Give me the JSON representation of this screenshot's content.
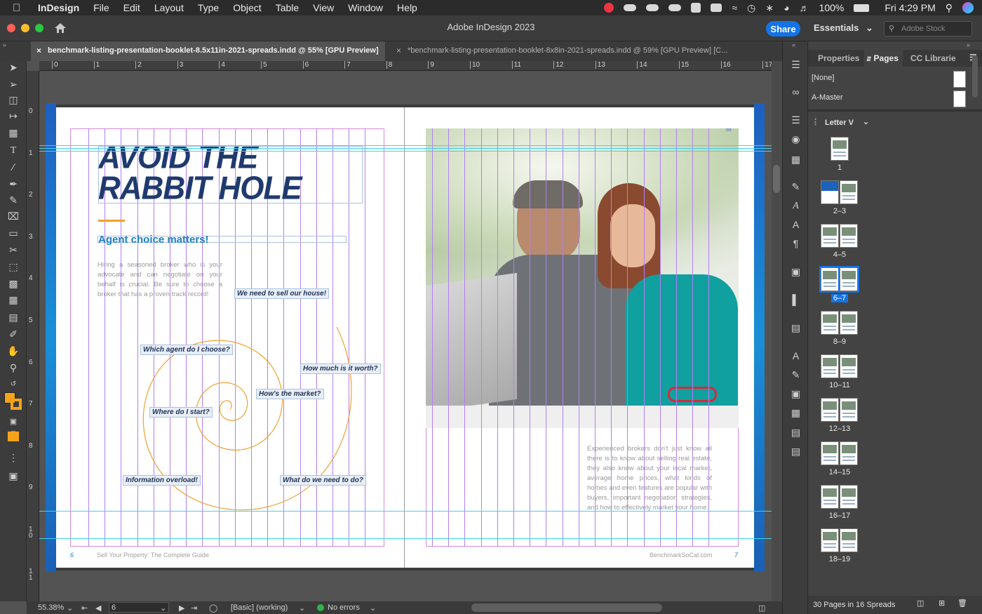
{
  "menubar": {
    "app": "InDesign",
    "items": [
      "File",
      "Edit",
      "Layout",
      "Type",
      "Object",
      "Table",
      "View",
      "Window",
      "Help"
    ],
    "battery": "100%",
    "clock": "Fri 4:29 PM"
  },
  "titlebar": {
    "title": "Adobe InDesign 2023",
    "share": "Share",
    "workspace": "Essentials",
    "stock_placeholder": "Adobe Stock"
  },
  "tabs": [
    {
      "label": "benchmark-listing-presentation-booklet-8.5x11in-2021-spreads.indd @ 55% [GPU Preview]",
      "active": true
    },
    {
      "label": "*benchmark-listing-presentation-booklet-8x8in-2021-spreads.indd @ 59% [GPU Preview] [C...",
      "active": false
    }
  ],
  "ruler": {
    "h": [
      "0",
      "1",
      "2",
      "3",
      "4",
      "5",
      "6",
      "7",
      "8",
      "9",
      "10",
      "11",
      "12",
      "13",
      "14",
      "15",
      "16",
      "17"
    ],
    "v": [
      "0",
      "1",
      "2",
      "3",
      "4",
      "5",
      "6",
      "7",
      "8",
      "9",
      "1\n0",
      "1\n1"
    ]
  },
  "document": {
    "headline_1": "AVOID THE",
    "headline_2": "RABBIT HOLE",
    "subhead": "Agent choice matters!",
    "intro": "Hiring a seasoned broker who is your advocate and can negotiate on your behalf is crucial. Be sure to choose a broker that has a proven track record!",
    "callouts": [
      "We need to sell our house!",
      "Which agent do I choose?",
      "How much is it worth?",
      "How's the market?",
      "Where do I start?",
      "Information overload!",
      "What do we need to do?"
    ],
    "body_right": "Experienced brokers don't just know all there is to know about selling real estate, they also know about your local market, average home prices, what kinds of homes and even features are popular with buyers, important negotiation strategies, and how to effectively market your home.",
    "footer_left_num": "6",
    "footer_left_text": "Sell Your Property: The Complete Guide",
    "footer_right_text": "BenchmarkSoCal.com",
    "footer_right_num": "7"
  },
  "statusbar": {
    "zoom": "55.38%",
    "page": "6",
    "style": "[Basic] (working)",
    "errors": "No errors"
  },
  "panel": {
    "tabs": [
      "Properties",
      "Pages",
      "CC Librarie"
    ],
    "active_tab": "Pages",
    "masters": [
      "[None]",
      "A-Master"
    ],
    "view_label": "Letter V",
    "spreads": [
      "1",
      "2–3",
      "4–5",
      "6–7",
      "8–9",
      "10–11",
      "12–13",
      "14–15",
      "16–17",
      "18–19"
    ],
    "selected_spread": "6–7",
    "footer": "30 Pages in 16 Spreads"
  },
  "colors": {
    "accent": "#1473e6",
    "headline": "#1f3a6e",
    "subhead": "#1a7fc4",
    "spiral": "#f0a030",
    "fill_swatch": "#f7a21b"
  }
}
